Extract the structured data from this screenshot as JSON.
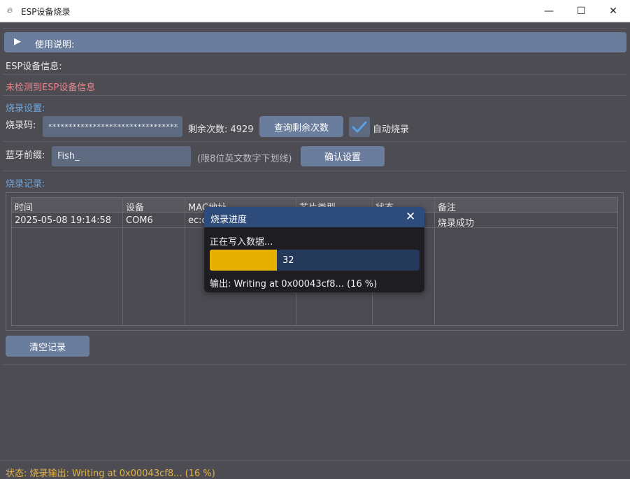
{
  "window": {
    "title": "ESP设备烧录",
    "icon": "burn-app-icon",
    "controls": {
      "minimize": "—",
      "maximize": "☐",
      "close": "✕"
    }
  },
  "instructions": {
    "label": "使用说明:",
    "arrow": "▶"
  },
  "device_info": {
    "heading": "ESP设备信息:",
    "status": "未检测到ESP设备信息"
  },
  "burn_settings": {
    "heading": "烧录设置:",
    "code_label": "烧录码:",
    "code_value": "********************************",
    "remaining_label": "剩余次数: 4929",
    "query_button": "查询剩余次数",
    "auto_burn_label": "自动烧录",
    "auto_burn_checked": true,
    "bt_prefix_label": "蓝牙前缀:",
    "bt_prefix_value": "Fish_",
    "bt_prefix_hint": "(限8位英文数字下划线)",
    "confirm_button": "确认设置"
  },
  "records": {
    "heading": "烧录记录:",
    "columns": [
      "时间",
      "设备",
      "MAC地址",
      "芯片类型",
      "状态",
      "备注"
    ],
    "rows": [
      [
        "2025-05-08 19:14:58",
        "COM6",
        "ec:c",
        "",
        "",
        "烧录成功"
      ]
    ],
    "clear_button": "清空记录"
  },
  "progress_dialog": {
    "title": "烧录进度",
    "close": "✕",
    "message": "正在写入数据...",
    "progress_percent": 32,
    "progress_text": "32",
    "output": "输出: Writing at 0x00043cf8... (16 %)"
  },
  "status_bar": {
    "text": "状态: 烧录输出: Writing at 0x00043cf8... (16 %)"
  },
  "colors": {
    "background": "#4d4c53",
    "button": "#6a7d9c",
    "accent_heading": "#6ea8e0",
    "error_text": "#e8868a",
    "progress_fill": "#e6b000",
    "status_text": "#e3b341"
  }
}
